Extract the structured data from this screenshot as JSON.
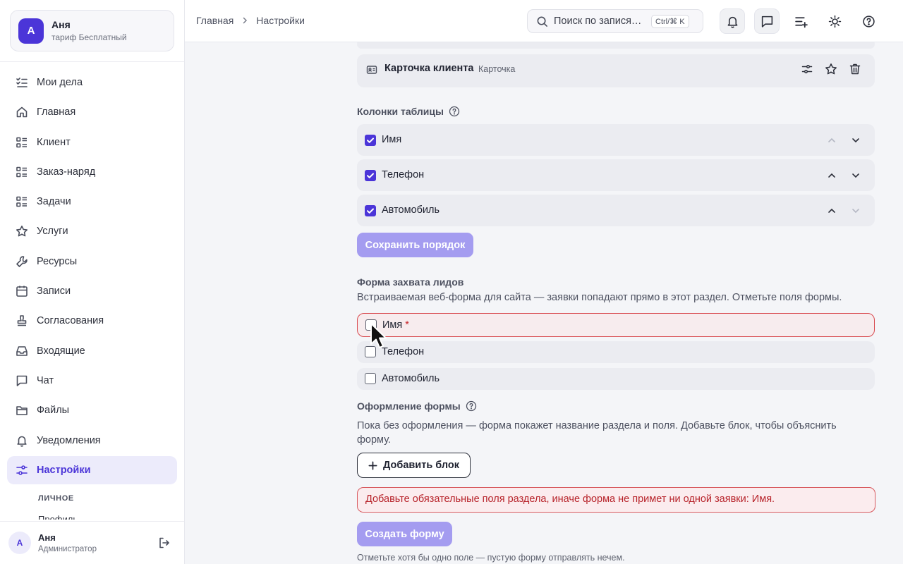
{
  "sidebar": {
    "account": {
      "initial": "А",
      "name": "Аня",
      "plan": "тариф Бесплатный"
    },
    "nav": [
      {
        "label": "Мои дела",
        "icon": "checklist-icon"
      },
      {
        "label": "Главная",
        "icon": "home-icon"
      },
      {
        "label": "Клиент",
        "icon": "list-icon"
      },
      {
        "label": "Заказ-наряд",
        "icon": "list-icon"
      },
      {
        "label": "Задачи",
        "icon": "list-icon"
      },
      {
        "label": "Услуги",
        "icon": "star-icon"
      },
      {
        "label": "Ресурсы",
        "icon": "wrench-icon"
      },
      {
        "label": "Записи",
        "icon": "calendar-icon"
      },
      {
        "label": "Согласования",
        "icon": "stamp-icon"
      },
      {
        "label": "Входящие",
        "icon": "inbox-icon"
      },
      {
        "label": "Чат",
        "icon": "chat-icon"
      },
      {
        "label": "Файлы",
        "icon": "folder-icon"
      },
      {
        "label": "Уведомления",
        "icon": "bell-icon"
      },
      {
        "label": "Настройки",
        "icon": "sliders-icon",
        "active": true
      }
    ],
    "group_label": "ЛИЧНОЕ",
    "sub_item": "Профиль",
    "user": {
      "initial": "А",
      "name": "Аня",
      "role": "Администратор"
    }
  },
  "topbar": {
    "breadcrumbs": [
      "Главная",
      "Настройки"
    ],
    "search": {
      "placeholder": "Поиск по записям…",
      "shortcut": "Ctrl/⌘ K"
    }
  },
  "main": {
    "client_card": {
      "title": "Карточка клиента",
      "subtitle": "Карточка"
    },
    "table_columns": {
      "title": "Колонки таблицы",
      "rows": [
        {
          "label": "Имя",
          "checked": true
        },
        {
          "label": "Телефон",
          "checked": true
        },
        {
          "label": "Автомобиль",
          "checked": true
        }
      ],
      "save_button": "Сохранить порядок"
    },
    "lead_form": {
      "title": "Форма захвата лидов",
      "description": "Встраиваемая веб-форма для сайта — заявки попадают прямо в этот раздел. Отметьте поля формы.",
      "fields": [
        {
          "label": "Имя",
          "required_mark": "*",
          "checked": false
        },
        {
          "label": "Телефон",
          "checked": false
        },
        {
          "label": "Автомобиль",
          "checked": false
        }
      ]
    },
    "form_design": {
      "title": "Оформление формы",
      "description": "Пока без оформления — форма покажет название раздела и поля. Добавьте блок, чтобы объяснить форму.",
      "add_block_button": "Добавить блок"
    },
    "alert": "Добавьте обязательные поля раздела, иначе форма не примет ни одной заявки: Имя.",
    "create_button": "Создать форму",
    "hint": "Отметьте хотя бы одно поле — пустую форму отправлять нечем."
  },
  "colors": {
    "accent": "#4b35d8",
    "accent_disabled": "#a49cf0",
    "error": "#c8262b"
  }
}
